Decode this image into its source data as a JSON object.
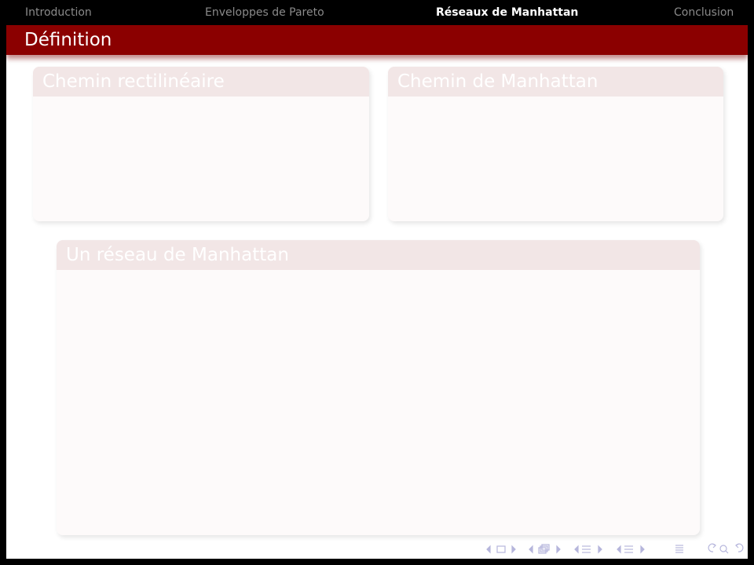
{
  "navigation": {
    "sections": [
      {
        "label": "Introduction",
        "active": false
      },
      {
        "label": "Enveloppes de Pareto",
        "active": false
      },
      {
        "label": "Réseaux de Manhattan",
        "active": true
      },
      {
        "label": "Conclusion",
        "active": false
      }
    ]
  },
  "frame": {
    "title": "Définition"
  },
  "blocks": [
    {
      "title": "Chemin rectilinéaire"
    },
    {
      "title": "Chemin de Manhattan"
    },
    {
      "title": "Un réseau de Manhattan"
    }
  ],
  "colors": {
    "title_bar": "#8b0000",
    "nav_background": "#000000",
    "nav_inactive_text": "#8a8a8a",
    "block_header": "#f2e6e6",
    "block_body": "#fdfafa",
    "nav_symbols": "#b6b6dc"
  },
  "nav_symbols": [
    "arrow-left-icon",
    "slide-icon",
    "arrow-right-icon",
    "arrow-left-icon",
    "frame-icon",
    "arrow-right-icon",
    "arrow-left-icon",
    "subsection-icon",
    "arrow-right-icon",
    "arrow-left-icon",
    "section-icon",
    "arrow-right-icon",
    "align-icon",
    "undo-icon",
    "search-icon",
    "redo-icon"
  ]
}
